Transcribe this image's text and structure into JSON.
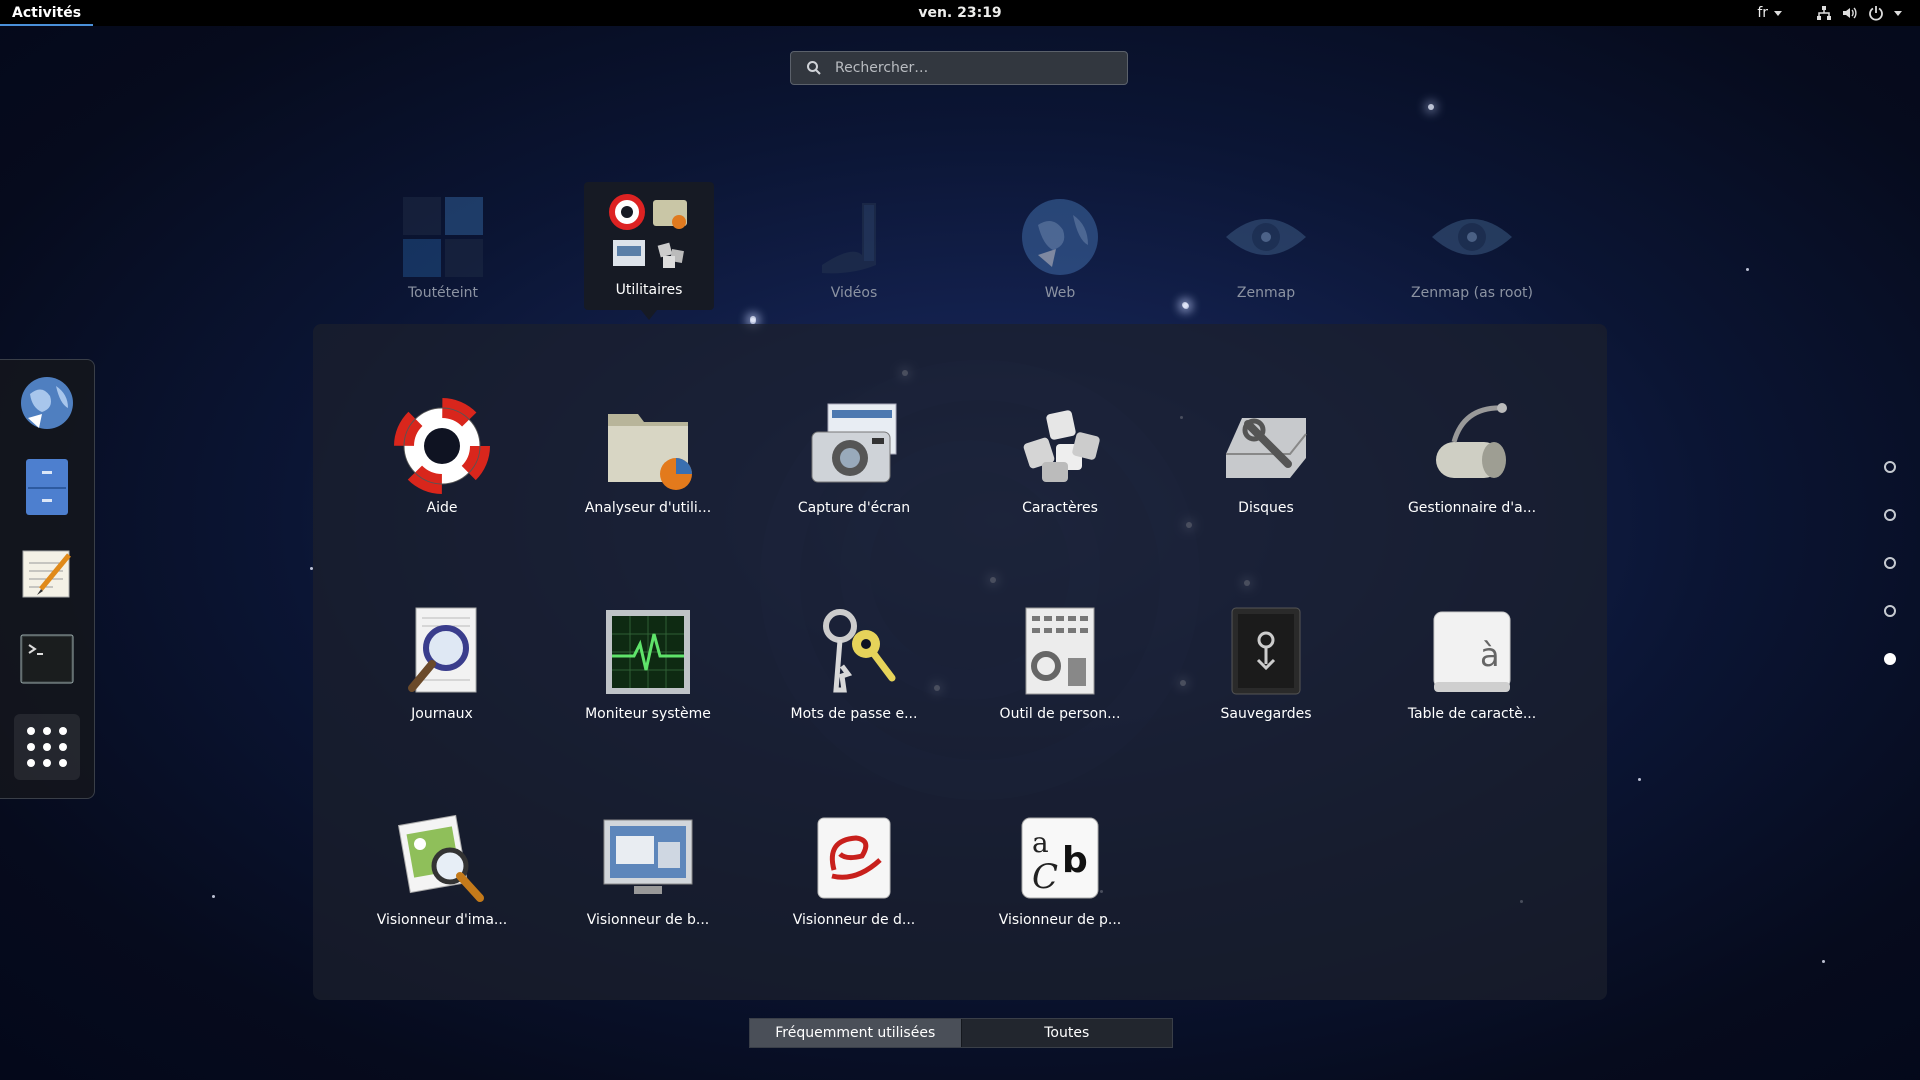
{
  "topbar": {
    "activities": "Activités",
    "clock": "ven. 23:19",
    "language": "fr"
  },
  "search": {
    "placeholder": "Rechercher…"
  },
  "folders": [
    {
      "label": "Toutéteint",
      "icon": "grid-tiles-icon"
    },
    {
      "label": "Utilitaires",
      "icon": "utilities-folder-icon"
    },
    {
      "label": "Vidéos",
      "icon": "film-icon"
    },
    {
      "label": "Web",
      "icon": "web-globe-icon"
    },
    {
      "label": "Zenmap",
      "icon": "eye-icon"
    },
    {
      "label": "Zenmap (as root)",
      "icon": "eye-icon"
    }
  ],
  "apps": [
    {
      "label": "Aide",
      "icon": "lifebuoy-icon"
    },
    {
      "label": "Analyseur d'utili...",
      "icon": "disk-usage-folder-icon"
    },
    {
      "label": "Capture d'écran",
      "icon": "camera-icon"
    },
    {
      "label": "Caractères",
      "icon": "keyboard-keys-icon"
    },
    {
      "label": "Disques",
      "icon": "disk-drive-icon"
    },
    {
      "label": "Gestionnaire d'a...",
      "icon": "archive-manager-icon"
    },
    {
      "label": "Journaux",
      "icon": "log-magnifier-icon"
    },
    {
      "label": "Moniteur système",
      "icon": "system-monitor-icon"
    },
    {
      "label": "Mots de passe e...",
      "icon": "keys-icon"
    },
    {
      "label": "Outil de person...",
      "icon": "tweak-tool-icon"
    },
    {
      "label": "Sauvegardes",
      "icon": "safe-icon"
    },
    {
      "label": "Table de caractè...",
      "icon": "character-map-icon"
    },
    {
      "label": "Visionneur d'ima...",
      "icon": "image-viewer-icon"
    },
    {
      "label": "Visionneur de b...",
      "icon": "remote-desktop-icon"
    },
    {
      "label": "Visionneur de d...",
      "icon": "document-viewer-icon"
    },
    {
      "label": "Visionneur de p...",
      "icon": "font-viewer-icon"
    }
  ],
  "dash": [
    {
      "icon": "web-browser-icon"
    },
    {
      "icon": "file-cabinet-icon"
    },
    {
      "icon": "text-editor-icon"
    },
    {
      "icon": "terminal-icon"
    },
    {
      "icon": "show-applications-icon"
    }
  ],
  "pages": {
    "count": 5,
    "active": 5
  },
  "view_toggle": {
    "frequent": "Fréquemment utilisées",
    "all": "Toutes",
    "selected": "frequent"
  },
  "colors": {
    "accent": "#4a90d9",
    "panel": "#1c202c",
    "topbar": "#000000"
  }
}
